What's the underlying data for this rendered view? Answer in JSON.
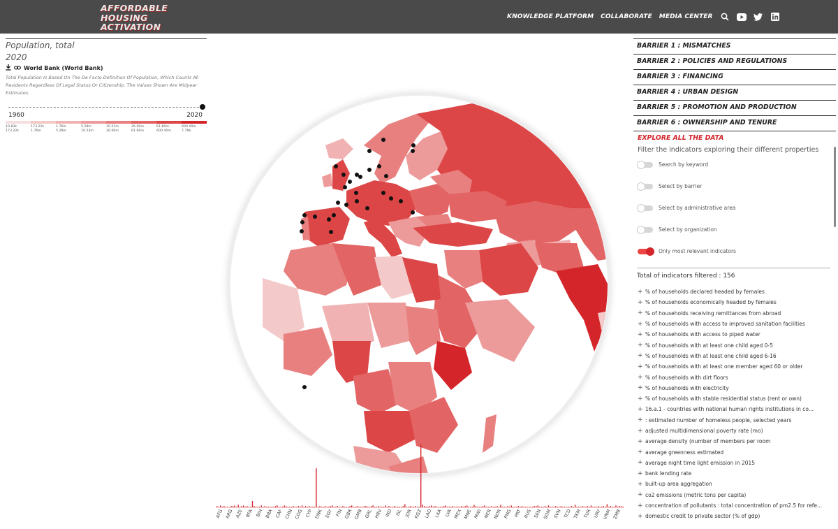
{
  "header": {
    "logo_lines": [
      "AFFORDABLE",
      "HOUSING",
      "ACTIVATION"
    ],
    "nav": [
      "KNOWLEDGE PLATFORM",
      "COLLABORATE",
      "MEDIA CENTER"
    ],
    "icons": [
      "search-icon",
      "youtube-icon",
      "twitter-icon",
      "linkedin-icon"
    ]
  },
  "indicator": {
    "title": "Population, total",
    "year": "2020",
    "source": "World Bank (World Bank)",
    "description": "Total Population Is Based On The De Facto Definition Of Population, Which Counts All Residents Regardless Of Legal Status Or Citizenship. The Values Shown Are Midyear Estimates.",
    "timeline_start": "1960",
    "timeline_end": "2020",
    "legend_colors": [
      "#f7dede",
      "#f4c9c9",
      "#f0b2b2",
      "#ec9a9a",
      "#e88080",
      "#e36464",
      "#dd4646",
      "#d4252a"
    ],
    "legend_labels": [
      [
        "10.83k",
        "173.22k"
      ],
      [
        "173.22k",
        "1.76m"
      ],
      [
        "1.76m",
        "5.28m"
      ],
      [
        "5.28m",
        "10.53m"
      ],
      [
        "10.53m",
        "26.00m"
      ],
      [
        "26.00m",
        "61.60m"
      ],
      [
        "61.60m",
        "600.40m"
      ],
      [
        "600.40m",
        "7.76b"
      ]
    ]
  },
  "barriers": [
    "BARRIER 1 : MISMATCHES",
    "BARRIER 2 : POLICIES AND REGULATIONS",
    "BARRIER 3 : FINANCING",
    "BARRIER 4 : URBAN DESIGN",
    "BARRIER 5 : PROMOTION AND PRODUCTION",
    "BARRIER 6 : OWNERSHIP AND TENURE"
  ],
  "explore": {
    "title": "EXPLORE ALL THE DATA",
    "hint": "Filter the indicators exploring their different properties",
    "toggles": [
      {
        "label": "Search by keyword",
        "on": false
      },
      {
        "label": "Select by barrier",
        "on": false
      },
      {
        "label": "Select by administrative area",
        "on": false
      },
      {
        "label": "Select by organization",
        "on": false
      },
      {
        "label": "Only most relevant indicators",
        "on": true
      }
    ],
    "total": "Total of indicators filtered : 156",
    "indicators": [
      "% of households declared headed by females",
      "% of households economically headed by females",
      "% of households receiving remittances from abroad",
      "% of households with access to improved sanitation facilities",
      "% of households with access to piped water",
      "% of households with at least one child aged 0-5",
      "% of households with at least one child aged 6-16",
      "% of households with at least one member aged 60 or older",
      "% of households with dirt floors",
      "% of households with electricity",
      "% of households with stable residential status (rent or own)",
      "16.a.1 - countries with national human rights institutions in co...",
      ": estimated number of homeless people, selected years",
      "adjusted multidimensional poverty rate (mo)",
      "average density (number of members per room",
      "average greenness estimated",
      "average night time light emission in 2015",
      "bank lending rate",
      "built-up area aggregation",
      "co2 emissions (metric tons per capita)",
      "concentration of pollutants : total concentration of pm2.5 for refe...",
      "domestic credit to private sector (% of gdp)"
    ]
  },
  "chart_data": {
    "type": "bar",
    "title": "",
    "xlabel": "",
    "ylabel": "",
    "color": "#d4252a",
    "tick_labels": [
      "AFG",
      "ARG",
      "AZE",
      "BFA",
      "BIH",
      "BRA",
      "CAF",
      "CHN",
      "COG",
      "CYP",
      "DNK",
      "EGY",
      "FIN",
      "GBR",
      "GMB",
      "GRL",
      "HRV",
      "IND",
      "ISL",
      "JOR",
      "KGZ",
      "LAO",
      "LKA",
      "LVA",
      "MEX",
      "MNE",
      "MWI",
      "NER",
      "NOR",
      "PNG",
      "PRT",
      "RUS",
      "SEN",
      "SOM",
      "SVN",
      "TCD",
      "TKM",
      "TUR",
      "URY",
      "VNM",
      "ZMB"
    ],
    "values": [
      2,
      1,
      3,
      1,
      2,
      1,
      1,
      0,
      2,
      2,
      3,
      1,
      4,
      1,
      2,
      3,
      1,
      2,
      1,
      1,
      10,
      2,
      1,
      1,
      1,
      3,
      1,
      2,
      1,
      1,
      1,
      1,
      1,
      2,
      3,
      1,
      1,
      1,
      3,
      2,
      1,
      1,
      1,
      2,
      1,
      1,
      2,
      1,
      3,
      1,
      2,
      1,
      2,
      1,
      1,
      1,
      62,
      1,
      2,
      1,
      1,
      2,
      1,
      1,
      2,
      3,
      1,
      1,
      2,
      1,
      1,
      2,
      1,
      1,
      1,
      2,
      3,
      1,
      1,
      2,
      1,
      1,
      1,
      2,
      2,
      1,
      1,
      2,
      3,
      1,
      1,
      2,
      1,
      1,
      1,
      3,
      1,
      2,
      1,
      1,
      2,
      1,
      1,
      1,
      1,
      2,
      5,
      1,
      1,
      2,
      1,
      1,
      2,
      1,
      1,
      100,
      4,
      2,
      1,
      1,
      2,
      3,
      1,
      2,
      1,
      1,
      1,
      1,
      2,
      3,
      1,
      1,
      1,
      2,
      1,
      1,
      1,
      1,
      2,
      1,
      2,
      3,
      1,
      1,
      1,
      4,
      2,
      1,
      1,
      1,
      2,
      3,
      1,
      1,
      1,
      2,
      1,
      1,
      2,
      1,
      4,
      1,
      1,
      1,
      2,
      1,
      3,
      1,
      1,
      1,
      2,
      1,
      2,
      1,
      1,
      1,
      1,
      1,
      1,
      2,
      2,
      3,
      1,
      1,
      1,
      2,
      1,
      3,
      1,
      1,
      1,
      2,
      1,
      1,
      2,
      1,
      1,
      1,
      1,
      1,
      2,
      1,
      4,
      1,
      1,
      1,
      2,
      1,
      1,
      2,
      1,
      3,
      1,
      1,
      1,
      2,
      1,
      1,
      2,
      1,
      5,
      1,
      2,
      1,
      1,
      3,
      1,
      2,
      2,
      1
    ]
  }
}
